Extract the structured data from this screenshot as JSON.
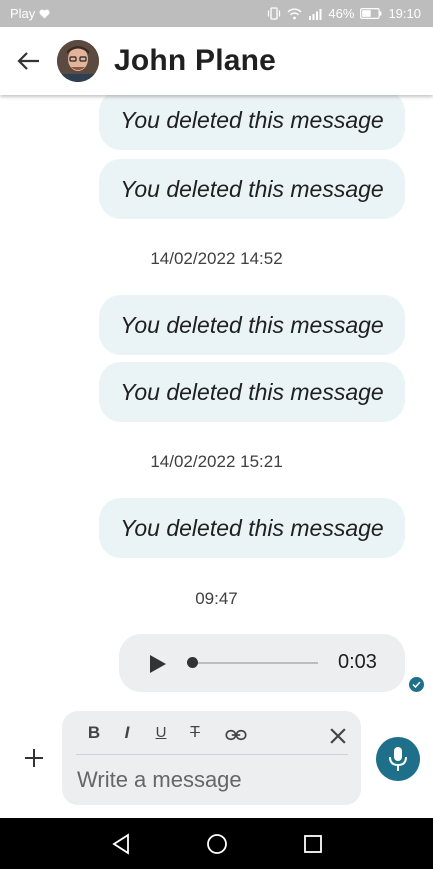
{
  "status_bar": {
    "carrier": "Play",
    "battery": "46%",
    "time": "19:10",
    "icons": [
      "heart-icon",
      "vibrate-icon",
      "wifi-icon",
      "signal-icon",
      "battery-icon"
    ]
  },
  "header": {
    "contact_name": "John Plane",
    "icons": [
      "back-arrow-icon",
      "avatar"
    ]
  },
  "messages": [
    {
      "type": "deleted",
      "text": "You deleted this message"
    },
    {
      "type": "deleted",
      "text": "You deleted this message"
    },
    {
      "type": "timestamp",
      "text": "14/02/2022 14:52"
    },
    {
      "type": "deleted",
      "text": "You deleted this message"
    },
    {
      "type": "deleted",
      "text": "You deleted this message"
    },
    {
      "type": "timestamp",
      "text": "14/02/2022 15:21"
    },
    {
      "type": "deleted",
      "text": "You deleted this message"
    },
    {
      "type": "timestamp",
      "text": "09:47"
    },
    {
      "type": "audio",
      "duration": "0:03",
      "progress": 0.0,
      "status": "read"
    }
  ],
  "composer": {
    "placeholder": "Write a message",
    "value": "",
    "formatting": [
      {
        "name": "bold",
        "label": "B"
      },
      {
        "name": "italic",
        "label": "I"
      },
      {
        "name": "underline",
        "label": "U"
      },
      {
        "name": "strikethrough",
        "label": "T"
      },
      {
        "name": "link",
        "label": ""
      }
    ]
  },
  "nav_bar": {
    "buttons": [
      "back",
      "home",
      "recents"
    ]
  },
  "colors": {
    "accent": "#1d6f8a",
    "bubble": "#eaf3f5",
    "status_bar": "#bdbdbd",
    "composer_bg": "#eceeef"
  }
}
